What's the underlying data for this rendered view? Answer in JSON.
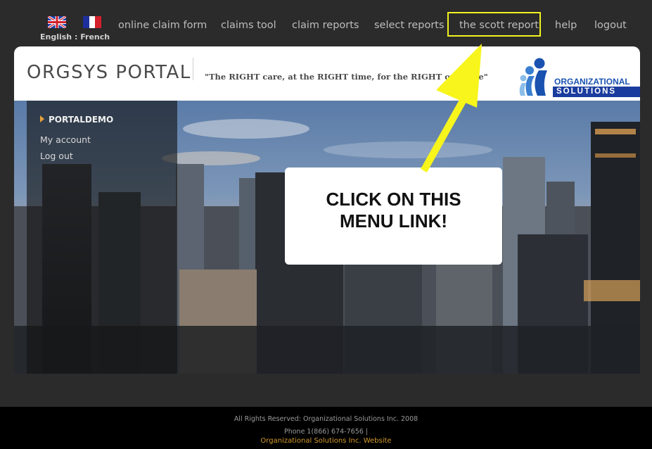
{
  "language": {
    "english": "English",
    "separator": " : ",
    "french": "French"
  },
  "nav": {
    "items": [
      {
        "label": "online claim form"
      },
      {
        "label": "claims tool"
      },
      {
        "label": "claim reports"
      },
      {
        "label": "select reports"
      },
      {
        "label": "the scott report"
      },
      {
        "label": "help"
      },
      {
        "label": "logout"
      }
    ]
  },
  "header": {
    "title": "ORGSYS PORTAL",
    "tagline": "\"The RIGHT care, at the RIGHT time, for the RIGHT outcome\"",
    "logo_line1": "ORGANIZATIONAL",
    "logo_line2": "SOLUTIONS"
  },
  "sidebar": {
    "user": "PORTALDEMO",
    "links": [
      {
        "label": "My account"
      },
      {
        "label": "Log out"
      }
    ]
  },
  "callout": {
    "text": "CLICK ON THIS MENU LINK!"
  },
  "footer": {
    "rights": "All Rights Reserved: Organizational Solutions Inc. 2008",
    "phone": "Phone 1(866) 674-7656 |",
    "website": "Organizational Solutions Inc. Website"
  },
  "colors": {
    "highlight": "#f1f221",
    "accent": "#d49a2a",
    "brand_blue": "#1a52b0"
  }
}
